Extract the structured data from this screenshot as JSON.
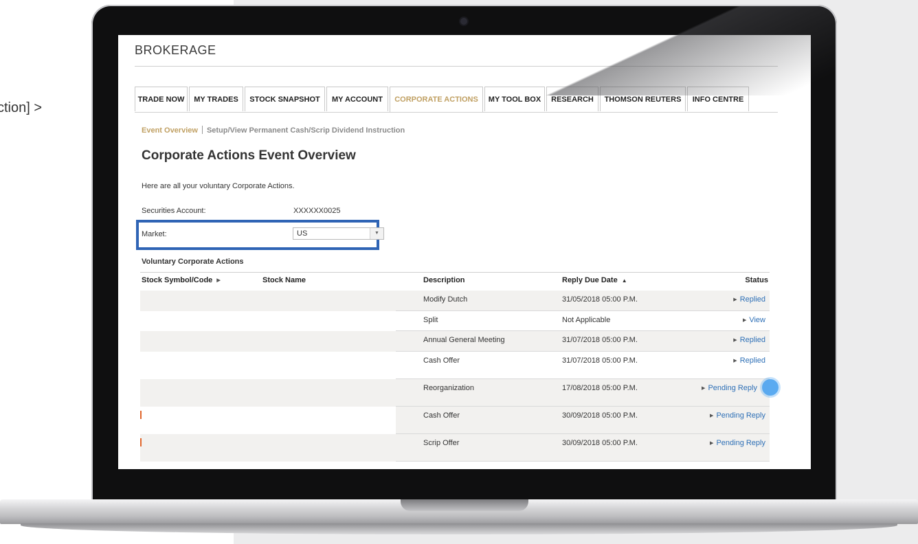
{
  "overlay": {
    "left_text": "ction] >"
  },
  "app": {
    "brand": "BROKERAGE"
  },
  "tabs": [
    {
      "label": "TRADE NOW"
    },
    {
      "label": "MY TRADES"
    },
    {
      "label": "STOCK SNAPSHOT"
    },
    {
      "label": "MY ACCOUNT"
    },
    {
      "label": "CORPORATE ACTIONS",
      "active": true
    },
    {
      "label": "MY TOOL BOX"
    },
    {
      "label": "RESEARCH"
    },
    {
      "label": "THOMSON REUTERS"
    },
    {
      "label": "INFO CENTRE"
    }
  ],
  "subnav": {
    "active": "Event Overview",
    "other": "Setup/View Permanent Cash/Scrip Dividend Instruction"
  },
  "page": {
    "title": "Corporate Actions Event Overview",
    "intro": "Here are all your voluntary Corporate Actions.",
    "securities_account_label": "Securities Account:",
    "securities_account_value": "XXXXXX0025",
    "market_label": "Market:",
    "market_value": "US",
    "section_title": "Voluntary Corporate Actions"
  },
  "table": {
    "headers": {
      "symbol": "Stock Symbol/Code",
      "name": "Stock Name",
      "description": "Description",
      "reply_due": "Reply Due Date",
      "status": "Status"
    },
    "rows": [
      {
        "description": "Modify Dutch",
        "reply_due": "31/05/2018 05:00 P.M.",
        "status": "Replied"
      },
      {
        "description": "Split",
        "reply_due": "Not Applicable",
        "status": "View"
      },
      {
        "description": "Annual General Meeting",
        "reply_due": "31/07/2018 05:00 P.M.",
        "status": "Replied"
      },
      {
        "description": "Cash Offer",
        "reply_due": "31/07/2018 05:00 P.M.",
        "status": "Replied"
      },
      {
        "description": "Reorganization",
        "reply_due": "17/08/2018 05:00 P.M.",
        "status": "Pending Reply"
      },
      {
        "description": "Cash Offer",
        "reply_due": "30/09/2018 05:00 P.M.",
        "status": "Pending Reply"
      },
      {
        "description": "Scrip Offer",
        "reply_due": "30/09/2018 05:00 P.M.",
        "status": "Pending Reply"
      }
    ]
  },
  "colors": {
    "accent_gold": "#c0a063",
    "link_blue": "#2d6fb6",
    "highlight_box": "#2f64b5",
    "tap_indicator": "#4aa2f0"
  },
  "icons": {
    "select_arrow": "chevron-down-icon",
    "sort_right": "triangle-right-icon",
    "sort_up": "triangle-up-icon",
    "status_bullet": "triangle-right-icon"
  }
}
